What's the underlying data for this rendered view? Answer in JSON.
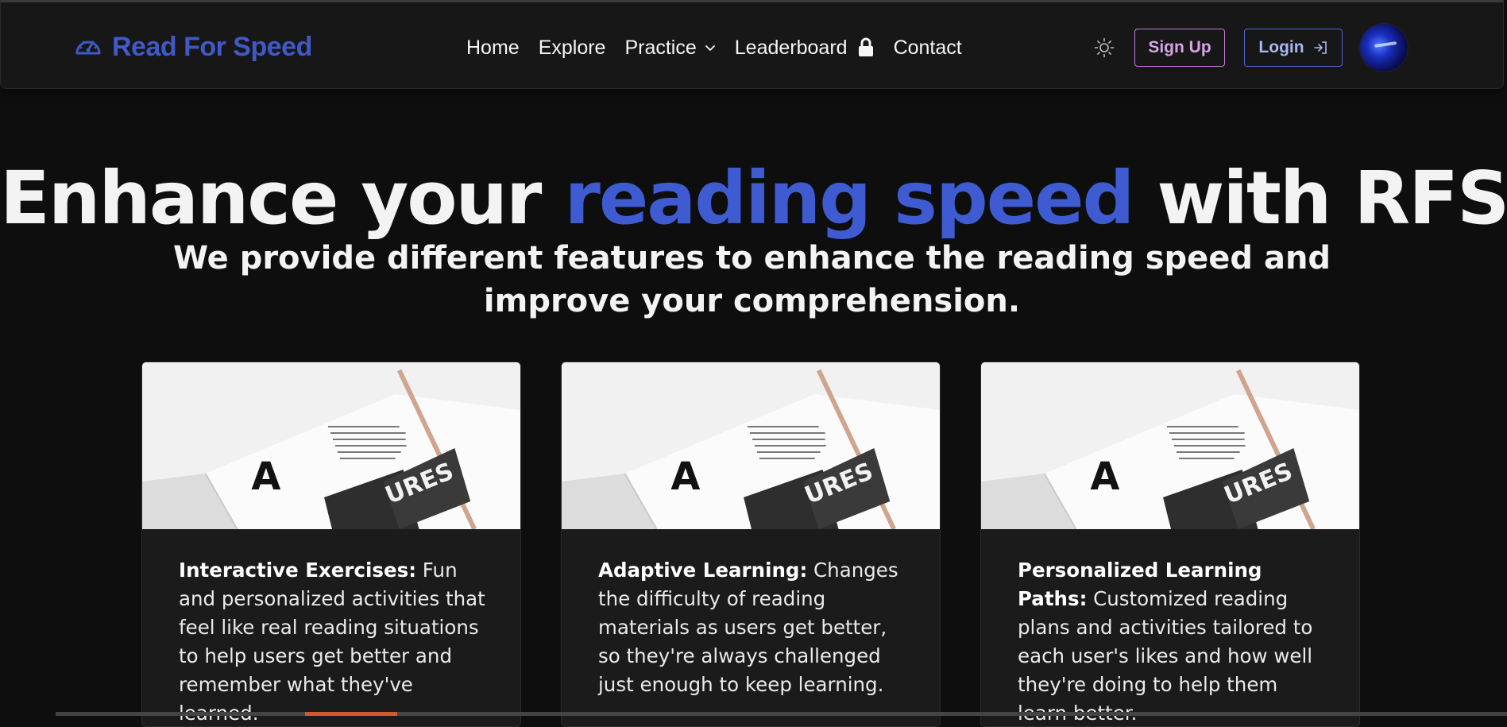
{
  "brand": {
    "name": "Read For Speed",
    "icon": "speedometer-icon",
    "color": "#4059c8"
  },
  "nav": {
    "items": [
      {
        "label": "Home"
      },
      {
        "label": "Explore"
      },
      {
        "label": "Practice",
        "icon": "chevron-down-icon"
      },
      {
        "label": "Leaderboard",
        "icon": "lock-icon"
      },
      {
        "label": "Contact"
      }
    ]
  },
  "header_actions": {
    "theme_toggle_icon": "sun-icon",
    "signup_label": "Sign Up",
    "login_label": "Login",
    "login_icon": "login-arrow-icon",
    "avatar": "avatar"
  },
  "hero": {
    "title_start": "Enhance your ",
    "title_accent": "reading speed",
    "title_end": " with RFS",
    "subtitle": "We provide different features to enhance the reading speed and improve your comprehension."
  },
  "cards": [
    {
      "title": "Interactive Exercises:",
      "text": " Fun and personalized activities that feel like real reading situations to help users get better and remember what they've learned."
    },
    {
      "title": "Adaptive Learning:",
      "text": " Changes the difficulty of reading materials as users get better, so they're always challenged just enough to keep learning."
    },
    {
      "title": "Personalized Learning Paths:",
      "text": " Customized reading plans and activities tailored to each user's likes and how well they're doing to help them learn better."
    }
  ],
  "card_image_text": {
    "letter": "A",
    "label": "URES"
  },
  "colors": {
    "background": "#0e0e0e",
    "navbar": "#171717",
    "accent": "#3e5bd1",
    "signup_border": "#c07ed6",
    "login_border": "#5066d6"
  }
}
